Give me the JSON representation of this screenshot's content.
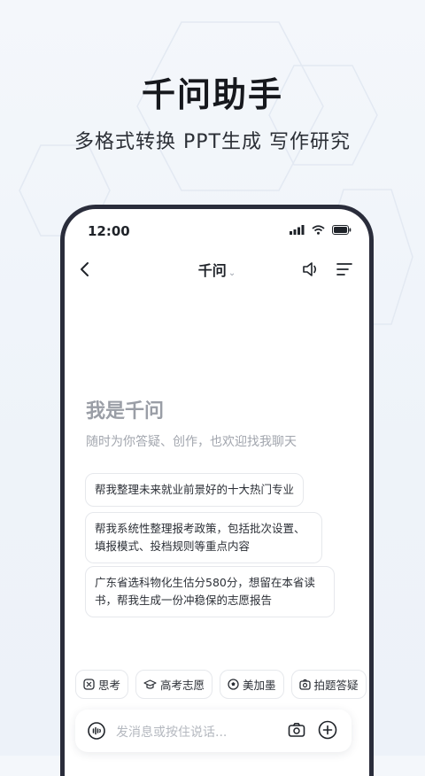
{
  "headline": "千问助手",
  "subline": "多格式转换  PPT生成  写作研究",
  "status": {
    "time": "12:00"
  },
  "nav": {
    "title": "千问"
  },
  "hero": {
    "title": "我是千问",
    "subtitle": "随时为你答疑、创作，也欢迎找我聊天"
  },
  "prompts": [
    {
      "text": "帮我整理未来就业前景好的十大热门专业"
    },
    {
      "text": "帮我系统性整理报考政策，包括批次设置、填报模式、投档规则等重点内容"
    },
    {
      "text": "广东省选科物化生估分580分，想留在本省读书，帮我生成一份冲稳保的志愿报告"
    }
  ],
  "chips": [
    {
      "label": "思考",
      "icon": "think-icon"
    },
    {
      "label": "高考志愿",
      "icon": "graduation-cap-icon"
    },
    {
      "label": "美加墨",
      "icon": "soccer-ball-icon"
    },
    {
      "label": "拍题答疑",
      "icon": "camera-scan-icon"
    }
  ],
  "input": {
    "placeholder": "发消息或按住说话..."
  },
  "colors": {
    "phone_frame": "#2a2d3b",
    "background": "#f1f5fa",
    "muted_text": "#9a9ea6"
  }
}
